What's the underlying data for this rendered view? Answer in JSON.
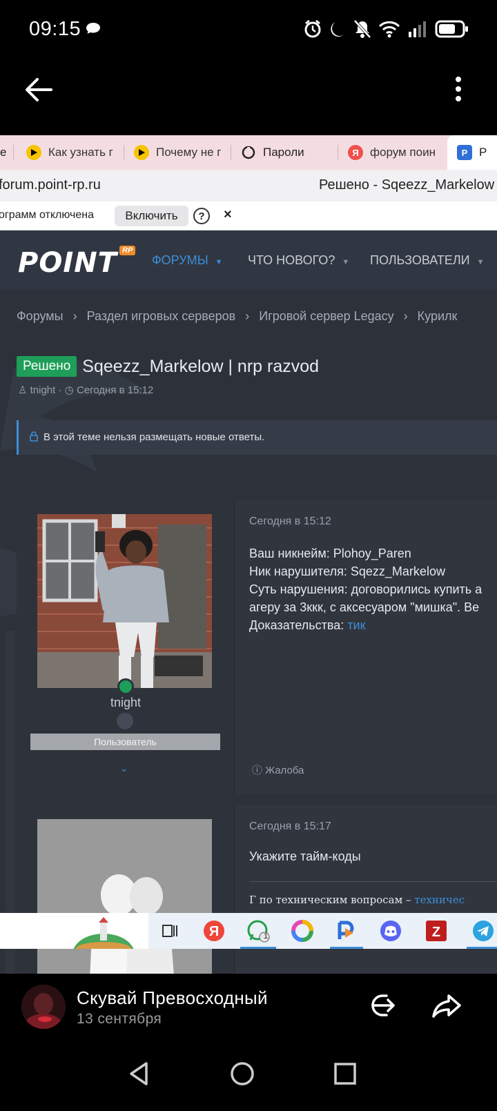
{
  "status_bar": {
    "time": "09:15",
    "icons": [
      "chat-bubble-icon",
      "alarm-icon",
      "moon-icon",
      "mute-icon",
      "wifi-icon",
      "signal-icon",
      "battery-icon"
    ]
  },
  "viewer": {
    "back_icon": "arrow-left-icon",
    "menu_icon": "more-vertical-icon"
  },
  "browser": {
    "tabs": [
      {
        "label": "е",
        "fav": "none"
      },
      {
        "label": "Как узнать г",
        "fav": "yandex-zen-icon"
      },
      {
        "label": "Почему не г",
        "fav": "yandex-zen-icon"
      },
      {
        "label": "Пароли",
        "fav": "key-icon"
      },
      {
        "label": "форум поин",
        "fav": "yandex-icon"
      },
      {
        "label": "P",
        "fav": "point-icon"
      }
    ],
    "url": "forum.point-rp.ru",
    "page_title": "Решено - Sqeezz_Markelow",
    "infobar": {
      "message": "ограмм отключена",
      "button": "Включить",
      "help": "?",
      "close": "×"
    }
  },
  "site": {
    "logo": "POINT",
    "logo_badge": "RP",
    "nav": [
      {
        "label": "ФОРУМЫ",
        "active": true
      },
      {
        "label": "ЧТО НОВОГО?",
        "active": false
      },
      {
        "label": "ПОЛЬЗОВАТЕЛИ",
        "active": false
      }
    ],
    "breadcrumbs": [
      "Форумы",
      "Раздел игровых серверов",
      "Игровой сервер Legacy",
      "Курилк"
    ],
    "badge": "Решено",
    "thread_title": "Sqeezz_Markelow | nrp razvod",
    "author": "tnight",
    "date_sep": "·",
    "created": "Сегодня в 15:12",
    "notice": "В этой теме нельзя размещать новые ответы.",
    "posts": [
      {
        "username": "tnight",
        "role": "Пользователь",
        "date": "Сегодня в 15:12",
        "lines": [
          "Ваш никнейм: Plohoy_Paren",
          "Ник нарушителя: Sqezz_Markelow",
          "Суть нарушения: договорились купить а",
          "агеру за 3ккк, с аксесуаром \"мишка\". Ве"
        ],
        "evidence_label": "Доказательства: ",
        "evidence_link": "тик",
        "report": "Жалоба"
      },
      {
        "date": "Сегодня в 15:17",
        "text": "Укажите тайм-коды",
        "quote_prefix": "Г  по техническим вопросам – ",
        "quote_link": "техничес"
      }
    ]
  },
  "taskbar": {
    "apps": [
      "task-view-icon",
      "yandex-icon",
      "whatsapp-icon",
      "photos-icon",
      "point-icon",
      "discord-icon",
      "filezilla-icon",
      "telegram-icon"
    ],
    "whatsapp_badge": "1"
  },
  "sender": {
    "name": "Скувай Превосходный",
    "date": "13 сентября"
  },
  "colors": {
    "accent": "#3d8ed8",
    "solved": "#1e9e58",
    "site_bg": "#2c313a"
  }
}
